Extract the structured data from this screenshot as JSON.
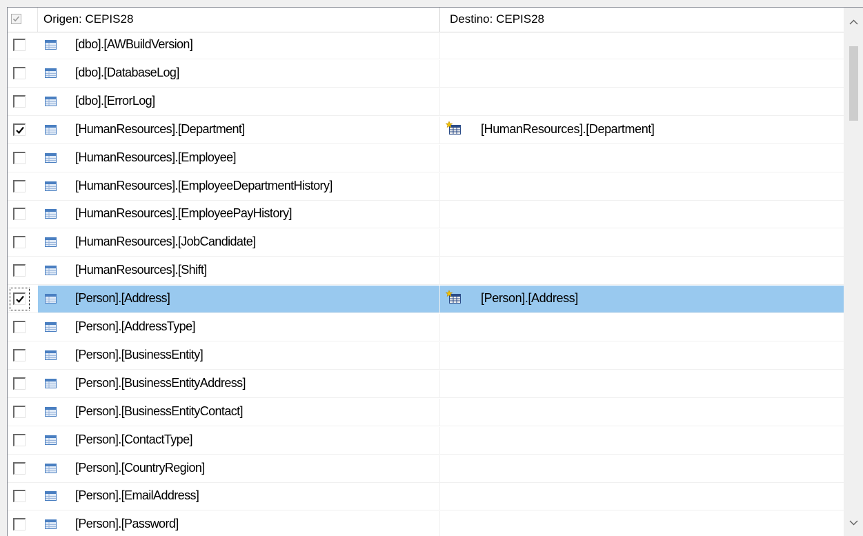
{
  "header": {
    "select_all_checked": true,
    "source_label": "Origen: CEPIS28",
    "destination_label": "Destino: CEPIS28"
  },
  "colors": {
    "selected_row": "#99c9ef",
    "table_icon": "#4a7fc1"
  },
  "rows": [
    {
      "source": "[dbo].[AWBuildVersion]",
      "destination": "",
      "checked": false
    },
    {
      "source": "[dbo].[DatabaseLog]",
      "destination": "",
      "checked": false
    },
    {
      "source": "[dbo].[ErrorLog]",
      "destination": "",
      "checked": false
    },
    {
      "source": "[HumanResources].[Department]",
      "destination": "[HumanResources].[Department]",
      "checked": true
    },
    {
      "source": "[HumanResources].[Employee]",
      "destination": "",
      "checked": false
    },
    {
      "source": "[HumanResources].[EmployeeDepartmentHistory]",
      "destination": "",
      "checked": false
    },
    {
      "source": "[HumanResources].[EmployeePayHistory]",
      "destination": "",
      "checked": false
    },
    {
      "source": "[HumanResources].[JobCandidate]",
      "destination": "",
      "checked": false
    },
    {
      "source": "[HumanResources].[Shift]",
      "destination": "",
      "checked": false
    },
    {
      "source": "[Person].[Address]",
      "destination": "[Person].[Address]",
      "checked": true,
      "selected": true
    },
    {
      "source": "[Person].[AddressType]",
      "destination": "",
      "checked": false
    },
    {
      "source": "[Person].[BusinessEntity]",
      "destination": "",
      "checked": false
    },
    {
      "source": "[Person].[BusinessEntityAddress]",
      "destination": "",
      "checked": false
    },
    {
      "source": "[Person].[BusinessEntityContact]",
      "destination": "",
      "checked": false
    },
    {
      "source": "[Person].[ContactType]",
      "destination": "",
      "checked": false
    },
    {
      "source": "[Person].[CountryRegion]",
      "destination": "",
      "checked": false
    },
    {
      "source": "[Person].[EmailAddress]",
      "destination": "",
      "checked": false
    },
    {
      "source": "[Person].[Password]",
      "destination": "",
      "checked": false
    }
  ],
  "icons": {
    "source_row": "table-icon",
    "destination_row": "new-table-icon",
    "scroll_up": "chevron-up-icon",
    "scroll_down": "chevron-down-icon"
  }
}
